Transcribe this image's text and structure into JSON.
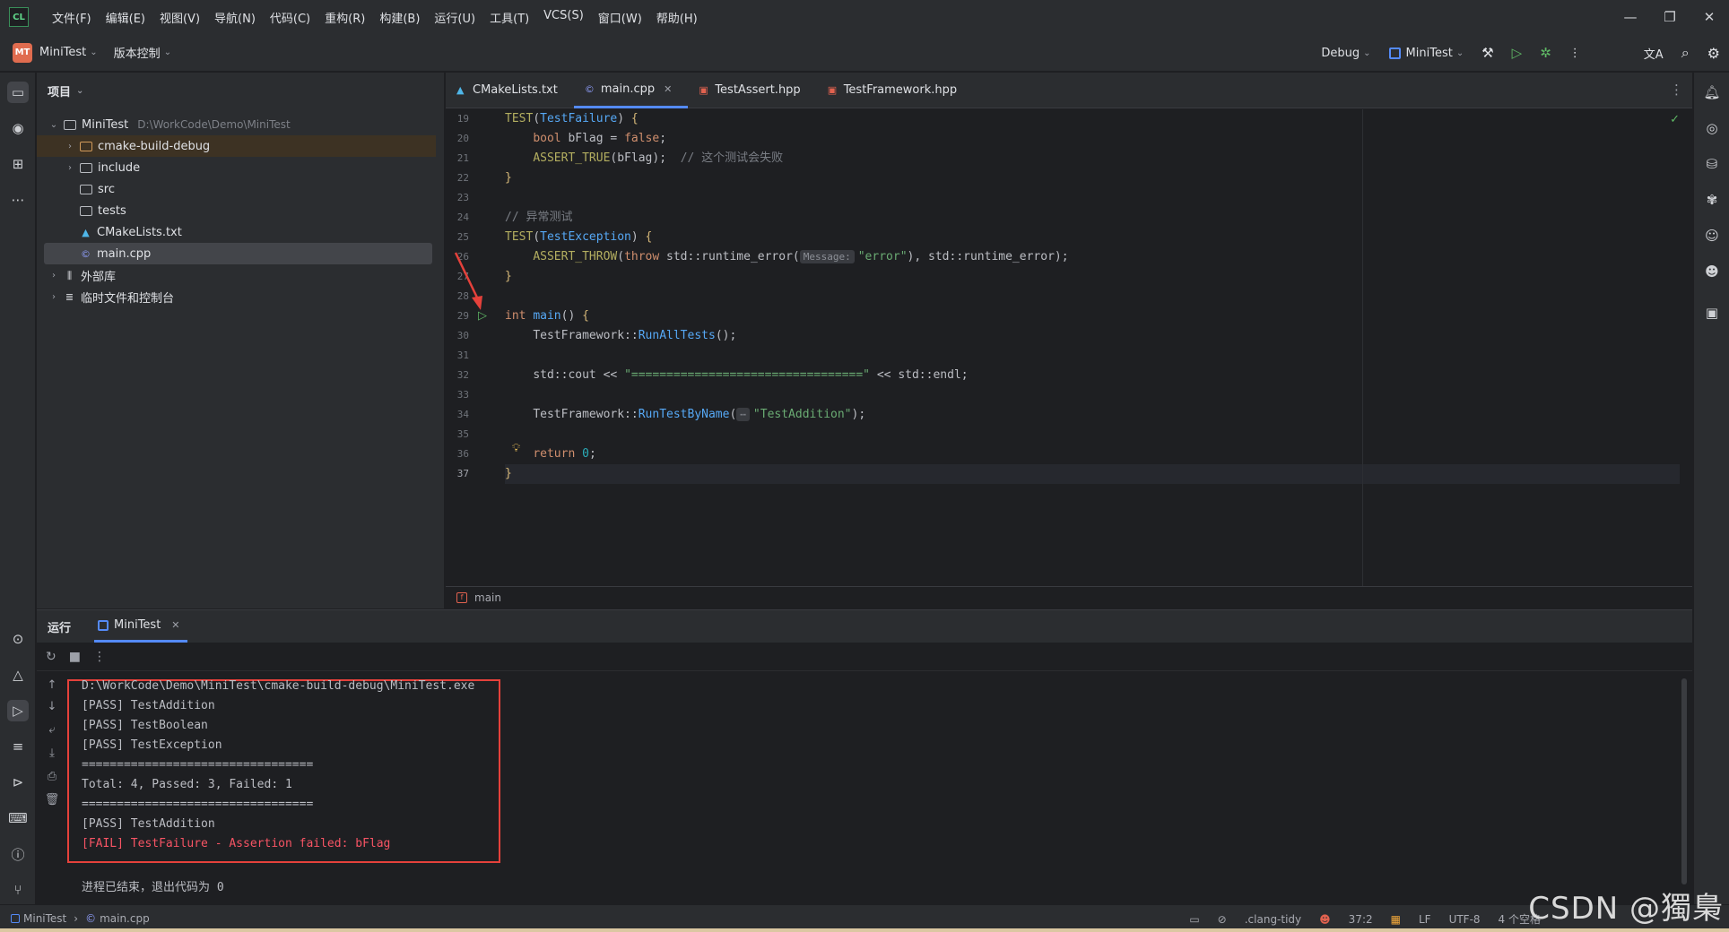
{
  "titlebar": {
    "logo": "CL",
    "menu": [
      "文件(F)",
      "编辑(E)",
      "视图(V)",
      "导航(N)",
      "代码(C)",
      "重构(R)",
      "构建(B)",
      "运行(U)",
      "工具(T)",
      "VCS(S)",
      "窗口(W)",
      "帮助(H)"
    ],
    "controls": [
      "—",
      "❐",
      "✕"
    ]
  },
  "toolbar": {
    "project_badge": "MT",
    "project_name": "MiniTest",
    "vcs_label": "版本控制",
    "config": "Debug",
    "target": "MiniTest"
  },
  "project_panel": {
    "title": "项目",
    "root": {
      "name": "MiniTest",
      "path": "D:\\WorkCode\\Demo\\MiniTest"
    },
    "items": [
      {
        "name": "cmake-build-debug",
        "kind": "folder"
      },
      {
        "name": "include",
        "kind": "folder"
      },
      {
        "name": "src",
        "kind": "folder"
      },
      {
        "name": "tests",
        "kind": "folder"
      },
      {
        "name": "CMakeLists.txt",
        "kind": "cmake"
      },
      {
        "name": "main.cpp",
        "kind": "cpp"
      }
    ],
    "external_libs": "外部库",
    "scratches": "临时文件和控制台"
  },
  "editor": {
    "tabs": [
      {
        "label": "CMakeLists.txt",
        "active": false
      },
      {
        "label": "main.cpp",
        "active": true
      },
      {
        "label": "TestAssert.hpp",
        "active": false
      },
      {
        "label": "TestFramework.hpp",
        "active": false
      }
    ],
    "line_numbers": [
      "19",
      "20",
      "21",
      "22",
      "23",
      "24",
      "25",
      "26",
      "27",
      "28",
      "29",
      "30",
      "31",
      "32",
      "33",
      "34",
      "35",
      "36",
      "37"
    ],
    "current_line": "37",
    "code": {
      "l19_test": "TEST",
      "l19_name": "TestFailure",
      "l20_type": "bool",
      "l20_var": "bFlag",
      "l20_val": "false",
      "l21_macro": "ASSERT_TRUE",
      "l21_arg": "bFlag",
      "l21_comment": "// 这个测试会失败",
      "l24_comment": "// 异常测试",
      "l25_name": "TestException",
      "l26_macro": "ASSERT_THROW",
      "l26_throw": "throw",
      "l26_ns": "std::runtime_error(",
      "l26_hint": "Message:",
      "l26_str": "\"error\"",
      "l26_rest": "), std::runtime_error);",
      "l29_type": "int",
      "l29_fn": "main",
      "l30_call": "TestFramework::",
      "l30_fn": "RunAllTests",
      "l32_cout": "std::cout",
      "l32_op": "<<",
      "l32_str": "\"=================================\"",
      "l32_endl": "std::endl;",
      "l34_call": "TestFramework::",
      "l34_fn": "RunTestByName",
      "l34_hint": "⋯",
      "l34_str": "\"TestAddition\"",
      "l36_ret": "return",
      "l36_num": "0"
    },
    "breadcrumb": "main"
  },
  "run_panel": {
    "title": "运行",
    "tab": "MiniTest",
    "output": [
      {
        "text": "D:\\WorkCode\\Demo\\MiniTest\\cmake-build-debug\\MiniTest.exe",
        "fail": false
      },
      {
        "text": "[PASS] TestAddition",
        "fail": false
      },
      {
        "text": "[PASS] TestBoolean",
        "fail": false
      },
      {
        "text": "[PASS] TestException",
        "fail": false
      },
      {
        "text": "=================================",
        "fail": false
      },
      {
        "text": "Total: 4, Passed: 3, Failed: 1",
        "fail": false
      },
      {
        "text": "=================================",
        "fail": false
      },
      {
        "text": "[PASS] TestAddition",
        "fail": false
      },
      {
        "text": "[FAIL] TestFailure - Assertion failed: bFlag",
        "fail": true
      }
    ],
    "exit_message": "进程已结束，退出代码为 0"
  },
  "statusbar": {
    "project": "MiniTest",
    "file": "main.cpp",
    "linter": ".clang-tidy",
    "position": "37:2",
    "line_sep": "LF",
    "encoding": "UTF-8",
    "indent": "4 个空格"
  },
  "watermark": "CSDN @獨梟",
  "colors": {
    "accent": "#548af7",
    "fail": "#f75464",
    "highlight_box": "#e5413b"
  }
}
